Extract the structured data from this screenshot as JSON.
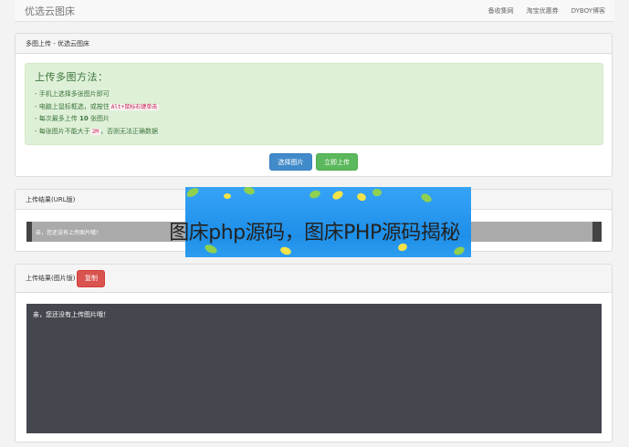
{
  "navbar": {
    "brand": "优选云图床",
    "links": [
      "备收集网",
      "淘宝优惠券",
      "DYBOY博客"
    ]
  },
  "upload_panel": {
    "heading": "多图上传 - 优选云图床",
    "alert_title": "上传多图方法：",
    "tips": [
      {
        "pre": "- 手机上选择多张图片即可",
        "code": "",
        "post": ""
      },
      {
        "pre": "- 电脑上鼠标框选，或按住",
        "code": "Alt+鼠标右键单击",
        "post": ""
      },
      {
        "pre": "- 每次最多上传 ",
        "bold": "10",
        "post": " 张图片"
      },
      {
        "pre": "- 每张图片不能大于",
        "code": "2M",
        "post": "，否则无法正确数据"
      }
    ],
    "select_button": "选择图片",
    "upload_button": "立即上传"
  },
  "url_panel": {
    "heading": "上传结果(URL版)",
    "empty_message": "亲，您还没有上传图片哦！"
  },
  "image_panel": {
    "heading": "上传结果(图片版)",
    "copy_button": "复制",
    "empty_message": "亲，您还没有上传图片哦！"
  },
  "overlay": {
    "title": "图床php源码，图床PHP源码揭秘"
  },
  "colors": {
    "primary": "#428bca",
    "success": "#5cb85c",
    "danger": "#d9534f",
    "alert_bg": "#dff0d8",
    "code_bg": "#45474f"
  }
}
